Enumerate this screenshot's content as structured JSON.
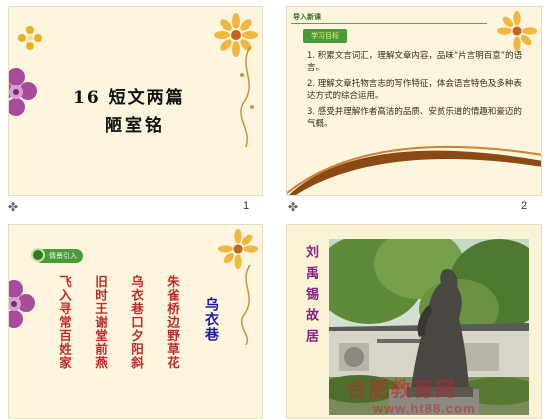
{
  "slides": [
    {
      "number": "1",
      "title_line1": "16 短文两篇",
      "title_line2": "陋室铭"
    },
    {
      "number": "2",
      "header": "导入新课",
      "tag": "学习目标",
      "goals": [
        "1. 积累文言词汇，理解文章内容，品味“片言明百意”的语言。",
        "2. 理解文章托物言志的写作特征，体会语言特色及多种表达方式的综合运用。",
        "3. 感受并理解作者高洁的品质、安贫乐道的情趣和豪迈的气概。"
      ]
    },
    {
      "number": "",
      "tag": "情景引入",
      "poem_title": "乌衣巷",
      "poem_lines": [
        "朱雀桥边野草花",
        "乌衣巷口夕阳斜",
        "旧时王谢堂前燕",
        "飞入寻常百姓家"
      ]
    },
    {
      "number": "",
      "vertical_caption": "刘禹锡故居",
      "watermark_cn": "合肥教育网",
      "watermark_url": "www.ht88.com"
    }
  ],
  "colors": {
    "slide_bg": "#fdf5dd",
    "title_text": "#111111",
    "goal_text": "#3a2a10",
    "poem_red": "#c0282a",
    "poem_blue": "#1a1aa8",
    "caption_purple": "#8a1e8a",
    "tag_green": "#4a9a3a",
    "arc_brown": "#8b4a14"
  },
  "icons": [
    "slide-show-icon",
    "flower-icon"
  ]
}
